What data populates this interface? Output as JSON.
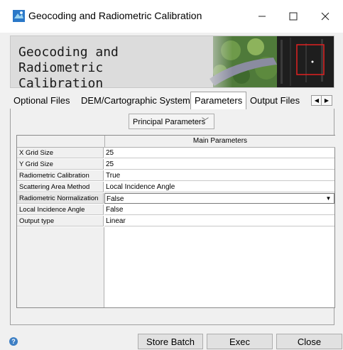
{
  "window": {
    "title": "Geocoding and Radiometric Calibration",
    "minimize_glyph": "—",
    "maximize_glyph": "☐",
    "close_glyph": "✕"
  },
  "banner": {
    "title_line1": "Geocoding and Radiometric",
    "title_line2": "Calibration"
  },
  "tabs": [
    {
      "label": "Optional Files",
      "active": false
    },
    {
      "label": "DEM/Cartographic System",
      "active": false
    },
    {
      "label": "Parameters",
      "active": true
    },
    {
      "label": "Output Files",
      "active": false
    }
  ],
  "parameters": {
    "group_select": "Principal Parameters",
    "column_header": "Main Parameters",
    "rows": [
      {
        "label": "X Grid Size",
        "value": "25"
      },
      {
        "label": "Y Grid Size",
        "value": "25"
      },
      {
        "label": "Radiometric Calibration",
        "value": "True"
      },
      {
        "label": "Scattering Area Method",
        "value": "Local Incidence Angle"
      },
      {
        "label": "Radiometric Normalization",
        "value": "False"
      },
      {
        "label": "Local Incidence Angle",
        "value": "False"
      },
      {
        "label": "Output type",
        "value": "Linear"
      }
    ]
  },
  "footer": {
    "help_glyph": "?",
    "store_batch": "Store Batch",
    "exec": "Exec",
    "close": "Close"
  },
  "colors": {
    "accent_help": "#3d7fc4",
    "banner_marker": "#e02020"
  },
  "icons": {
    "app": "app-logo-icon",
    "help": "help-icon",
    "tab_left": "scroll-left-icon",
    "tab_right": "scroll-right-icon",
    "combo": "chevron-down-icon"
  }
}
